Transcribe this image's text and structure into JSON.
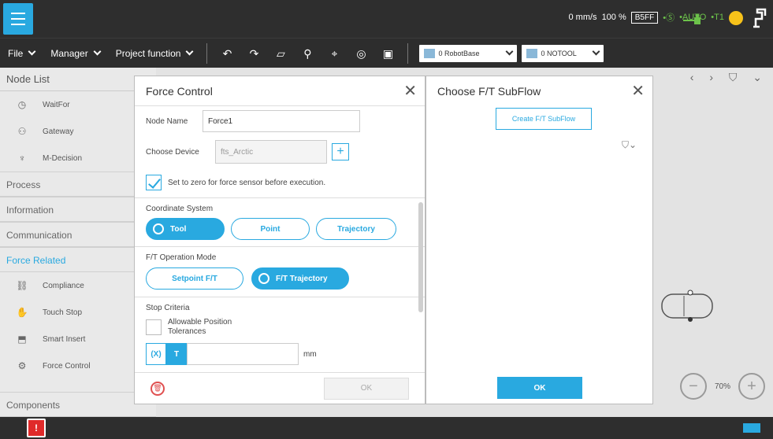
{
  "status": {
    "speed": "0 mm/s",
    "percent": "100 %",
    "code": "B5FF",
    "mode_auto": "•AUTO",
    "mode_t1": "•T1"
  },
  "toolbar": {
    "file": "File",
    "manager": "Manager",
    "project_function": "Project function",
    "robot_base": "0 RobotBase",
    "tool": "0 NOTOOL"
  },
  "nodelist": {
    "title": "Node List",
    "items_top": [
      {
        "label": "WaitFor",
        "icon": "clock-icon"
      },
      {
        "label": "Gateway",
        "icon": "gateway-icon"
      },
      {
        "label": "M-Decision",
        "icon": "decision-icon"
      }
    ],
    "categories": [
      "Process",
      "Information",
      "Communication",
      "Force Related"
    ],
    "force_items": [
      {
        "label": "Compliance",
        "icon": "compliance-icon"
      },
      {
        "label": "Touch Stop",
        "icon": "touch-stop-icon"
      },
      {
        "label": "Smart Insert",
        "icon": "smart-insert-icon"
      },
      {
        "label": "Force Control",
        "icon": "force-control-icon"
      }
    ],
    "components": "Components"
  },
  "force_dialog": {
    "title": "Force Control",
    "node_name_label": "Node Name",
    "node_name_value": "Force1",
    "choose_device_label": "Choose Device",
    "device_value": "fts_Arctic",
    "zero_label": "Set to zero for force sensor before execution.",
    "coord_label": "Coordinate System",
    "coord_options": [
      "Tool",
      "Point",
      "Trajectory"
    ],
    "mode_label": "F/T Operation Mode",
    "mode_options": [
      "Setpoint F/T",
      "F/T Trajectory"
    ],
    "stop_label": "Stop Criteria",
    "allow_pos_label": "Allowable Position Tolerances",
    "axis_x": "(X)",
    "axis_t": "T",
    "unit": "mm",
    "ok": "OK"
  },
  "subflow_dialog": {
    "title": "Choose F/T SubFlow",
    "create": "Create F/T SubFlow",
    "ok": "OK"
  },
  "zoom": {
    "value": "70%"
  },
  "colors": {
    "accent": "#29a9e0",
    "bar": "#2e2e2e",
    "alert": "#e02a2a"
  }
}
